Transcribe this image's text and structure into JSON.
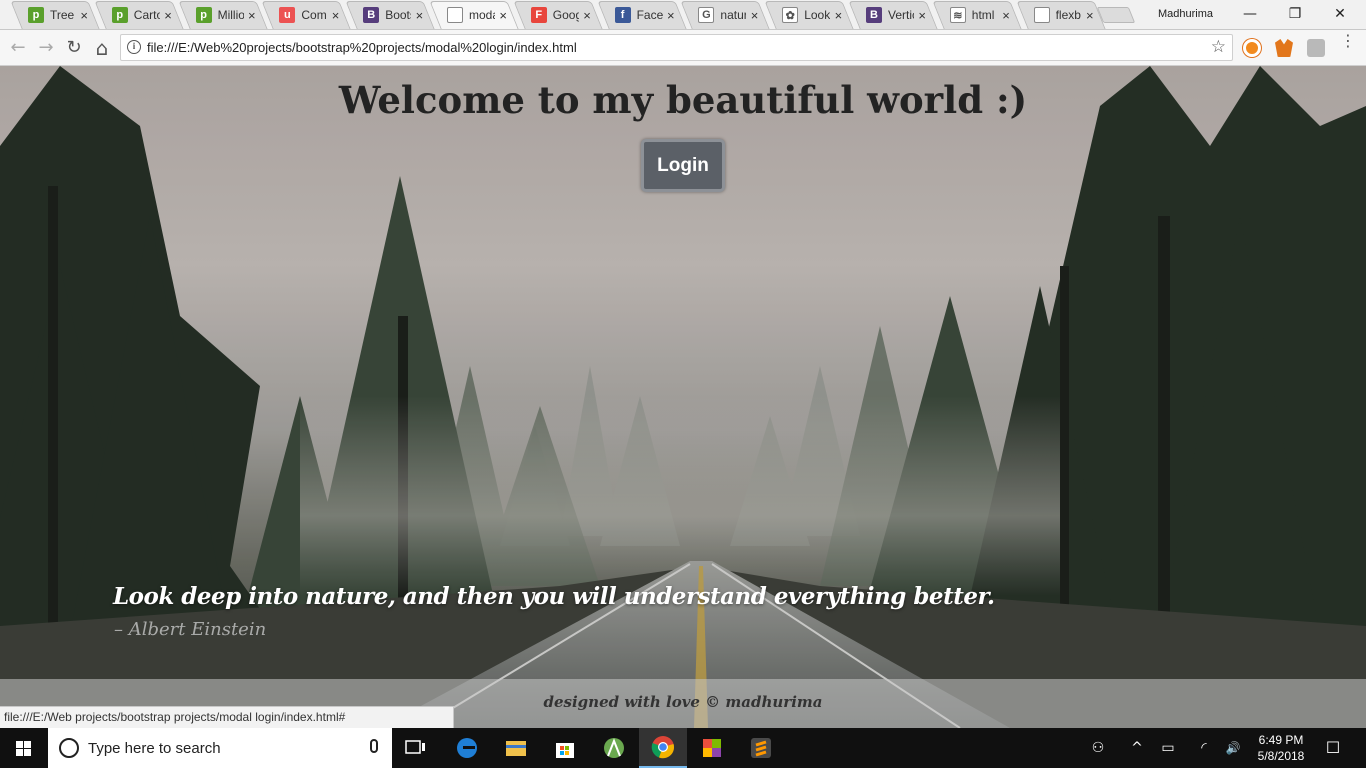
{
  "browser": {
    "tabs": [
      {
        "label": "Tree",
        "icon": "p-icon",
        "color": "#5aa02c",
        "glyph": "p"
      },
      {
        "label": "Carto",
        "icon": "p-icon",
        "color": "#5aa02c",
        "glyph": "p"
      },
      {
        "label": "Millio",
        "icon": "p-icon",
        "color": "#5aa02c",
        "glyph": "p"
      },
      {
        "label": "Comp",
        "icon": "udemy-icon",
        "color": "#ec5252",
        "glyph": "u"
      },
      {
        "label": "Boots",
        "icon": "bootstrap-icon",
        "color": "#563d7c",
        "glyph": "B"
      },
      {
        "label": "moda",
        "icon": "file-icon",
        "color": "#ffffff",
        "glyph": ""
      },
      {
        "label": "Goog",
        "icon": "google-icon",
        "color": "#e8453c",
        "glyph": "F"
      },
      {
        "label": "Faceb",
        "icon": "facebook-icon",
        "color": "#3b5998",
        "glyph": "f"
      },
      {
        "label": "natur",
        "icon": "google-g-icon",
        "color": "#ffffff",
        "glyph": "G"
      },
      {
        "label": "Looki",
        "icon": "pinwheel-icon",
        "color": "#ffffff",
        "glyph": "✿"
      },
      {
        "label": "Vertic",
        "icon": "bootstrap-icon",
        "color": "#563d7c",
        "glyph": "B"
      },
      {
        "label": "html",
        "icon": "stackoverflow-icon",
        "color": "#ffffff",
        "glyph": "≋"
      },
      {
        "label": "flexb",
        "icon": "file-icon",
        "color": "#ffffff",
        "glyph": ""
      }
    ],
    "active_tab_index": 5,
    "close_glyph": "×",
    "user_name": "Madhurima",
    "window_controls": {
      "minimize": "—",
      "restore": "❐",
      "close": "✕"
    },
    "nav": {
      "back": "←",
      "forward": "→",
      "reload": "↻",
      "home": "⌂"
    },
    "address": "file:///E:/Web%20projects/bootstrap%20projects/modal%20login/index.html",
    "info_glyph": "i",
    "bookmark_glyph": "☆",
    "menu_glyph": "⋮"
  },
  "page": {
    "heading": "Welcome to my beautiful world :)",
    "login_button": "Login",
    "quote": "Look deep into nature, and then you will understand everything better.",
    "author": "– Albert Einstein",
    "footer": "designed with love © madhurima",
    "status_url": "file:///E:/Web projects/bootstrap projects/modal login/index.html#"
  },
  "taskbar": {
    "search_placeholder": "Type here to search",
    "time": "6:49 PM",
    "date": "5/8/2018",
    "apps": [
      "task-view",
      "edge",
      "file-explorer",
      "store",
      "android-studio",
      "chrome",
      "app-grid",
      "sublime-text"
    ],
    "tray_glyphs": {
      "people": "⚇",
      "chevron": "^",
      "battery": "▭",
      "wifi": "◜",
      "volume": "🔊",
      "notifications": "☐"
    }
  }
}
